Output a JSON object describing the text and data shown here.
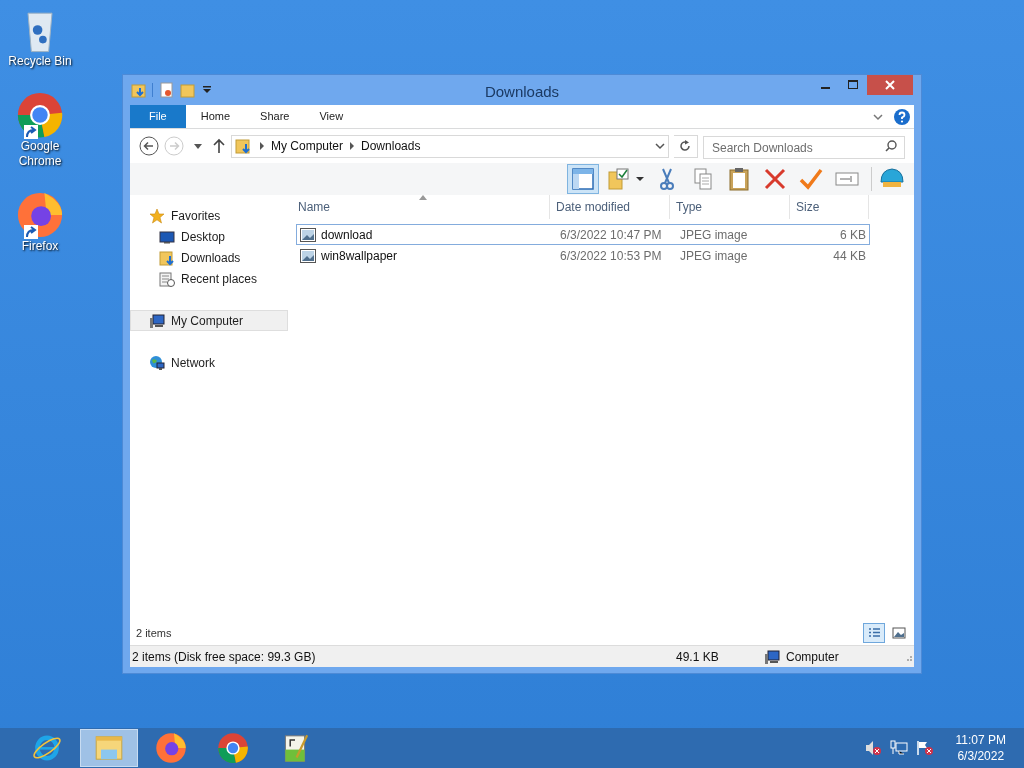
{
  "desktop_icons": [
    {
      "kind": "recycle",
      "label": "Recycle Bin",
      "shortcut": false
    },
    {
      "kind": "chrome",
      "label": "Google Chrome",
      "shortcut": true
    },
    {
      "kind": "firefox",
      "label": "Firefox",
      "shortcut": true
    }
  ],
  "window": {
    "title": "Downloads"
  },
  "ribbon_tabs": [
    {
      "label": "File",
      "selected": true
    },
    {
      "label": "Home",
      "selected": false
    },
    {
      "label": "Share",
      "selected": false
    },
    {
      "label": "View",
      "selected": false
    }
  ],
  "address": {
    "path": [
      "My Computer",
      "Downloads"
    ]
  },
  "search": {
    "placeholder": "Search Downloads"
  },
  "toolbar": [
    {
      "kind": "pane",
      "selected": true
    },
    {
      "kind": "folder",
      "selected": false
    },
    {
      "kind": "cut",
      "selected": false
    },
    {
      "kind": "copy",
      "selected": false
    },
    {
      "kind": "paste",
      "selected": false
    },
    {
      "kind": "delete",
      "selected": false
    },
    {
      "kind": "check",
      "selected": false
    },
    {
      "kind": "rename",
      "selected": false
    },
    {
      "kind": "shell",
      "selected": false
    }
  ],
  "nav": [
    {
      "kind": "favorites",
      "label": "Favorites",
      "selected": false,
      "children": [
        {
          "kind": "desktop",
          "label": "Desktop",
          "selected": false
        },
        {
          "kind": "downloads",
          "label": "Downloads",
          "selected": false
        },
        {
          "kind": "recent",
          "label": "Recent places",
          "selected": false
        }
      ]
    },
    {
      "kind": "computer",
      "label": "My Computer",
      "selected": true
    },
    {
      "kind": "network",
      "label": "Network",
      "selected": false
    }
  ],
  "table": {
    "columns": [
      "Name",
      "Date modified",
      "Type",
      "Size"
    ],
    "rows": [
      {
        "name": "download",
        "date": "6/3/2022 10:47 PM",
        "type": "JPEG image",
        "size": "6 KB",
        "selected": true
      },
      {
        "name": "win8wallpaper",
        "date": "6/3/2022 10:53 PM",
        "type": "JPEG image",
        "size": "44 KB",
        "selected": false
      }
    ]
  },
  "item_count": "2 items",
  "views": [
    {
      "kind": "details",
      "selected": true
    },
    {
      "kind": "large",
      "selected": false
    }
  ],
  "status_bar": {
    "info": "2 items (Disk free space: 99.3 GB)",
    "size": "49.1 KB",
    "location": "Computer"
  },
  "taskbar": [
    {
      "kind": "ie",
      "selected": false
    },
    {
      "kind": "explorer",
      "selected": true
    },
    {
      "kind": "firefox",
      "selected": false
    },
    {
      "kind": "chrome",
      "selected": false
    },
    {
      "kind": "notepad",
      "selected": false
    }
  ],
  "clock": {
    "time": "11:07 PM",
    "date": "6/3/2022"
  }
}
